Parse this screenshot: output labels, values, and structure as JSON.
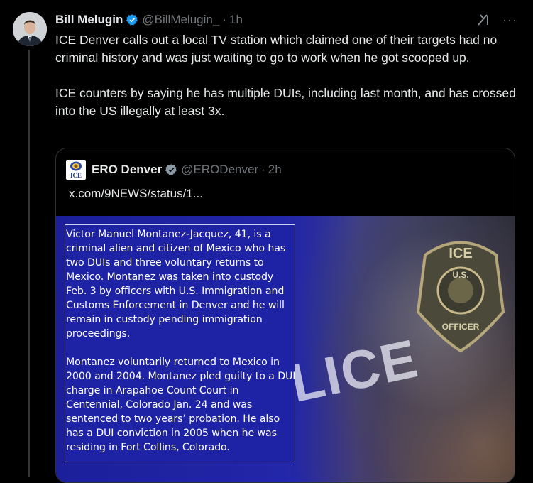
{
  "tweet": {
    "display_name": "Bill Melugin",
    "handle": "@BillMelugin_",
    "dot": "·",
    "time": "1h",
    "paragraphs": [
      "ICE Denver calls out a local TV station which claimed one of their targets had no criminal history and was just waiting to go to work when he got scooped up.",
      "ICE counters by saying he has multiple DUIs, including last month, and has crossed into the US illegally at least 3x."
    ],
    "more_label": "···"
  },
  "quote": {
    "display_name": "ERO Denver",
    "handle": "@ERODenver",
    "dot": "·",
    "time": "2h",
    "logo_text": "ICE",
    "link": "x.com/9NEWS/status/1...",
    "image": {
      "paragraphs": [
        "Victor Manuel Montanez-Jacquez, 41, is a criminal alien and citizen of Mexico who has two DUIs and three voluntary returns to Mexico. Montanez was taken into custody Feb. 3 by officers with U.S. Immigration and Customs Enforcement in Denver and he will remain in custody pending immigration proceedings.",
        "Montanez voluntarily returned to Mexico in 2000 and 2004. Montanez pled guilty to a DUI charge in Arapahoe Count Court in Centennial, Colorado Jan. 24 and was sentenced to two years’ probation. He also has a DUI conviction in 2005 when he was residing in Fort Collins, Colorado."
      ],
      "photo_text": "LICE",
      "badge_top": "ICE",
      "badge_mid": "U.S.",
      "badge_bottom": "OFFICER"
    }
  },
  "colors": {
    "background": "#000000",
    "text": "#e7e9ea",
    "muted": "#71767b",
    "verified": "#1d9bf0",
    "image_blue": "#1e22a4"
  },
  "icons": [
    "verified-badge-icon",
    "grok-icon",
    "more-icon",
    "ice-logo-icon"
  ]
}
